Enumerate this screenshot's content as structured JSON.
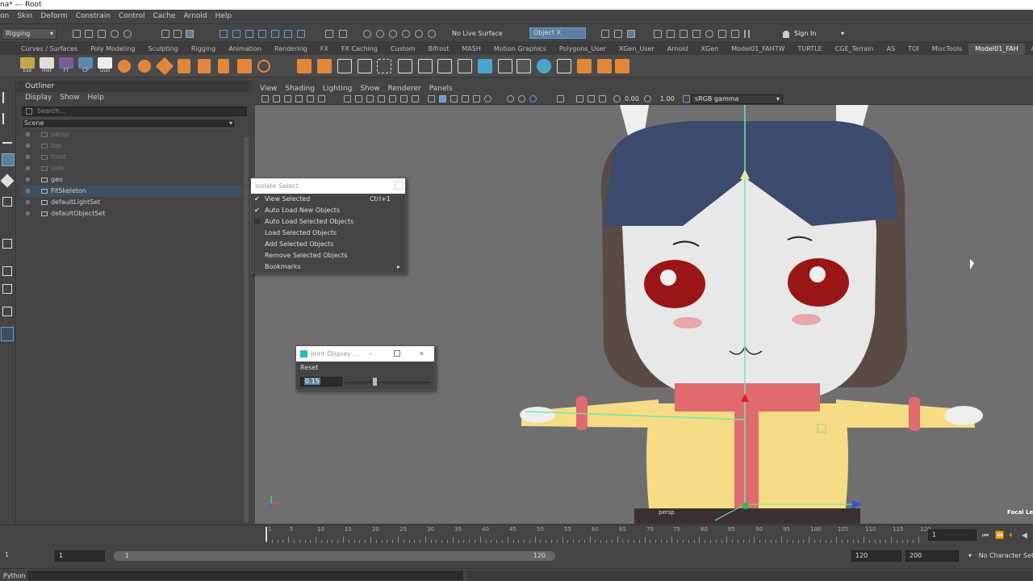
{
  "titlebar": {
    "text": "na*  ---  Root"
  },
  "menubar": {
    "items": [
      "on",
      "Skin",
      "Deform",
      "Constrain",
      "Control",
      "Cache",
      "Arnold",
      "Help"
    ]
  },
  "statusline": {
    "mode": "Rigging",
    "live_surface": "No Live Surface",
    "object_field": "Object X",
    "sign_in": "Sign In"
  },
  "shelf": {
    "tabs": [
      "Curves / Surfaces",
      "Poly Modeling",
      "Sculpting",
      "Rigging",
      "Animation",
      "Rendering",
      "FX",
      "FX Caching",
      "Custom",
      "Bifrost",
      "MASH",
      "Motion Graphics",
      "Polygons_User",
      "XGen_User",
      "Arnold",
      "XGen",
      "Model01_FAHTW",
      "TURTLE",
      "CGE_Terrain",
      "AS",
      "TOI",
      "MiscTools",
      "Model01_FAH",
      "Animate"
    ],
    "selected_tab": "Model01_FAH",
    "icon_labels": [
      "Eso",
      "Hist",
      "FT",
      "CP",
      "Outl"
    ]
  },
  "outliner": {
    "title": "Outliner",
    "menus": [
      "Display",
      "Show",
      "Help"
    ],
    "search_placeholder": "Search...",
    "scene_label": "Scene",
    "items": [
      {
        "name": "persp",
        "dim": true
      },
      {
        "name": "top",
        "dim": true
      },
      {
        "name": "front",
        "dim": true
      },
      {
        "name": "side",
        "dim": true
      },
      {
        "name": "geo",
        "dim": false
      },
      {
        "name": "FitSkeleton",
        "dim": false
      },
      {
        "name": "defaultLightSet",
        "dim": false
      },
      {
        "name": "defaultObjectSet",
        "dim": false
      }
    ]
  },
  "viewport": {
    "menus": [
      "View",
      "Shading",
      "Lighting",
      "Show",
      "Renderer",
      "Panels"
    ],
    "value_a": "0.00",
    "value_b": "1.00",
    "color_space": "sRGB gamma",
    "camera_label": "persp",
    "focal_label": "Focal Ler"
  },
  "isolate_popup": {
    "title": "Isolate Select",
    "items": [
      {
        "label": "View Selected",
        "checked": true,
        "shortcut": "Ctrl+1"
      },
      {
        "label": "Auto Load New Objects",
        "checked": true,
        "shortcut": ""
      },
      {
        "label": "Auto Load Selected Objects",
        "checked": false,
        "shortcut": ""
      },
      {
        "label": "Load Selected Objects",
        "checked": false,
        "shortcut": ""
      },
      {
        "label": "Add Selected Objects",
        "checked": false,
        "shortcut": ""
      },
      {
        "label": "Remove Selected Objects",
        "checked": false,
        "shortcut": ""
      },
      {
        "label": "Bookmarks",
        "checked": false,
        "shortcut": "▸"
      }
    ]
  },
  "joint_dialog": {
    "title": "Joint Display ...",
    "reset_label": "Reset",
    "value": "0.15",
    "slider_fraction": 0.35
  },
  "timeline": {
    "ticks": [
      "1",
      "5",
      "10",
      "15",
      "20",
      "25",
      "30",
      "35",
      "40",
      "45",
      "50",
      "55",
      "60",
      "65",
      "70",
      "75",
      "80",
      "85",
      "90",
      "95",
      "100",
      "105",
      "110",
      "115",
      "120"
    ],
    "current_frame": "1"
  },
  "range": {
    "start": "1",
    "anim_start": "1",
    "range_start": "1",
    "range_end": "120",
    "anim_end_a": "120",
    "anim_end_b": "200",
    "character_set": "No Character Set"
  },
  "cmdline": {
    "label": "Python"
  }
}
